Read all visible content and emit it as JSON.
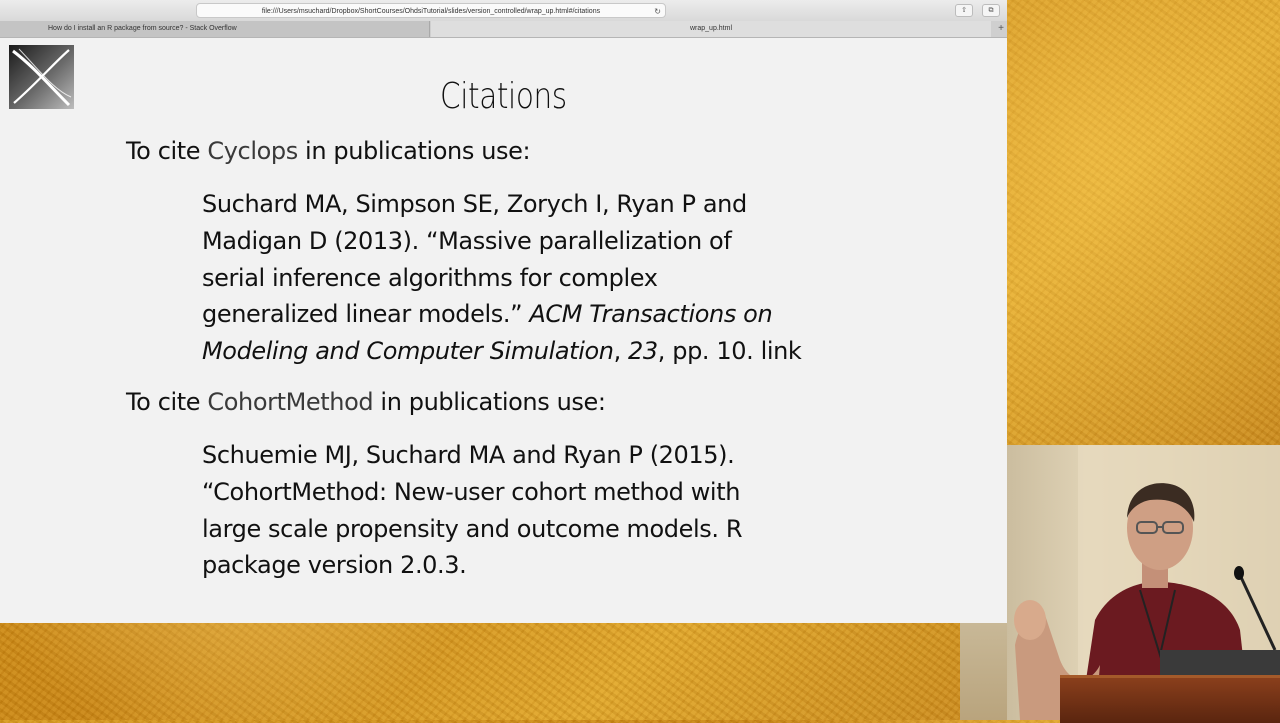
{
  "browser": {
    "url": "file:///Users/msuchard/Dropbox/ShortCourses/OhdsiTutorial/slides/version_controlled/wrap_up.html#/citations",
    "tabs": [
      {
        "label": "How do I install an R package from source? - Stack Overflow"
      },
      {
        "label": "wrap_up.html"
      }
    ],
    "new_tab_label": "+"
  },
  "slide": {
    "title": "Citations",
    "sections": [
      {
        "lead_prefix": "To cite ",
        "package": "Cyclops",
        "lead_suffix": " in publications use:",
        "citation_lines": [
          "Suchard MA, Simpson SE, Zorych I, Ryan P and",
          "Madigan D (2013). “Massive parallelization of",
          "serial inference algorithms for complex",
          "generalized linear models.”"
        ],
        "journal_part1": "ACM Transactions on",
        "journal_part2": "Modeling and Computer Simulation",
        "volume": "23",
        "pages_suffix": ", pp. 10. link"
      },
      {
        "lead_prefix": "To cite ",
        "package": "CohortMethod",
        "lead_suffix": " in publications use:",
        "citation_lines": [
          "Schuemie MJ, Suchard MA and Ryan P (2015).",
          "“CohortMethod: New-user cohort method with",
          "large scale propensity and outcome models. R",
          "package version 2.0.3."
        ]
      }
    ]
  }
}
